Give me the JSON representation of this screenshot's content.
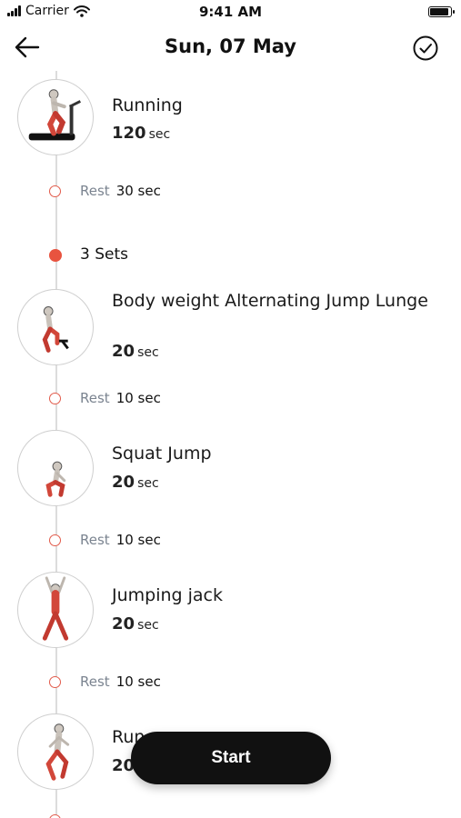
{
  "status_bar": {
    "carrier": "Carrier",
    "time": "9:41 AM"
  },
  "nav": {
    "title": "Sun, 07 May",
    "back_icon": "arrow-left-icon",
    "confirm_icon": "check-circle-icon"
  },
  "timeline": {
    "first_exercise": {
      "name": "Running",
      "duration_value": "120",
      "duration_unit": "sec"
    },
    "first_rest": {
      "label": "Rest",
      "value": "30 sec"
    },
    "sets_label": "3 Sets",
    "exercises": [
      {
        "name": "Body weight Alternating Jump Lunge",
        "duration_value": "20",
        "duration_unit": "sec"
      },
      {
        "name": "Squat Jump",
        "duration_value": "20",
        "duration_unit": "sec"
      },
      {
        "name": "Jumping jack",
        "duration_value": "20",
        "duration_unit": "sec"
      },
      {
        "name": "Run",
        "duration_value": "20",
        "duration_unit": ""
      }
    ],
    "rests": [
      {
        "label": "Rest",
        "value": "10 sec"
      },
      {
        "label": "Rest",
        "value": "10 sec"
      },
      {
        "label": "Rest",
        "value": "10 sec"
      }
    ]
  },
  "start_button": {
    "label": "Start"
  },
  "colors": {
    "accent": "#e8533f",
    "rest_dot": "#e25b4b",
    "button": "#111111"
  }
}
